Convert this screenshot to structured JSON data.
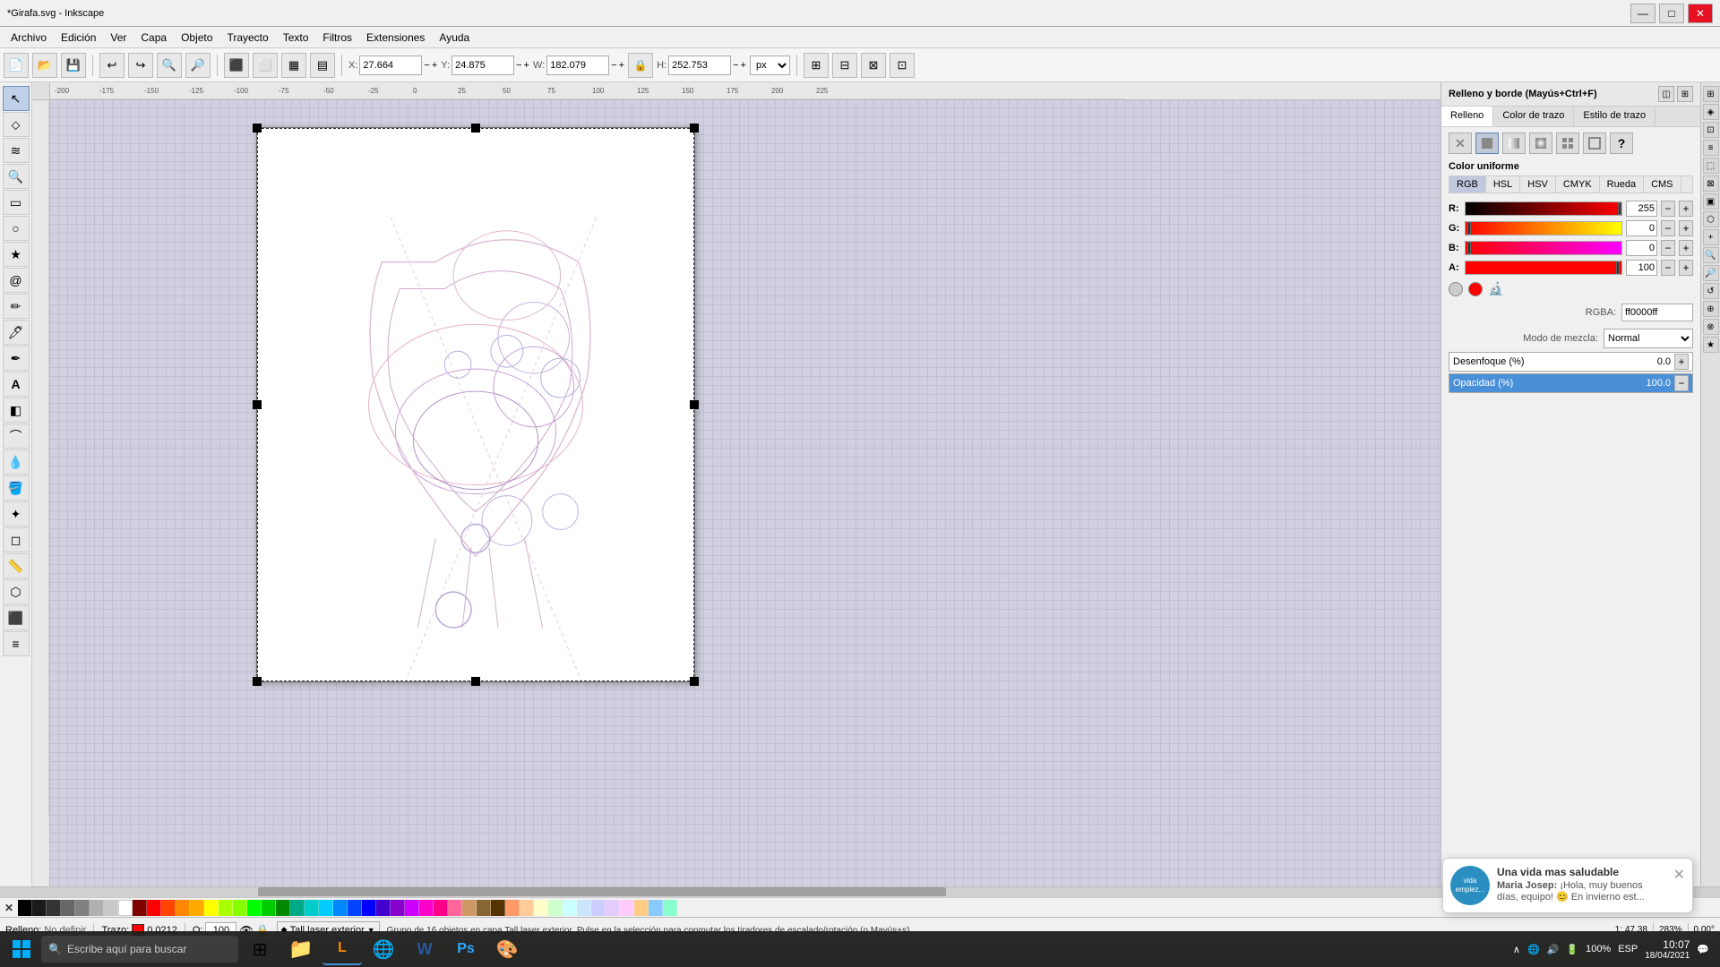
{
  "window": {
    "title": "*Girafa.svg - Inkscape",
    "controls": {
      "minimize": "—",
      "maximize": "□",
      "close": "✕"
    }
  },
  "menubar": {
    "items": [
      "Archivo",
      "Edición",
      "Ver",
      "Capa",
      "Objeto",
      "Trayecto",
      "Texto",
      "Filtros",
      "Extensiones",
      "Ayuda"
    ]
  },
  "toolbar": {
    "x_label": "X:",
    "x_value": "27.664",
    "y_label": "Y:",
    "y_value": "24.875",
    "w_label": "W:",
    "w_value": "182.079",
    "h_label": "H:",
    "h_value": "252.753",
    "unit": "px"
  },
  "panel": {
    "title": "Relleno y borde (Mayús+Ctrl+F)",
    "tabs": [
      "Relleno",
      "Color de trazo",
      "Estilo de trazo"
    ],
    "fill_types": [
      "?",
      "□",
      "□",
      "□",
      "□",
      "□",
      "?"
    ],
    "color_label": "Color uniforme",
    "color_mode_tabs": [
      "RGB",
      "HSL",
      "HSV",
      "CMYK",
      "Rueda",
      "CMS"
    ],
    "r_label": "R:",
    "r_value": "255",
    "g_label": "G:",
    "g_value": "0",
    "b_label": "B:",
    "b_value": "0",
    "a_label": "A:",
    "a_value": "100",
    "rgba_label": "RGBA:",
    "rgba_value": "ff0000ff",
    "blend_label": "Modo de mezcla:",
    "blend_value": "Normal",
    "blur_label": "Desenfoque (%)",
    "blur_value": "0.0",
    "opacity_label": "Opacidad (%)",
    "opacity_value": "100.0"
  },
  "statusbar": {
    "fill_label": "Relleno:",
    "fill_value": "No definir",
    "stroke_label": "Trazo:",
    "opacity_label": "O:",
    "opacity_value": "100",
    "layer_selector": "Tall laser exterior",
    "status_text": "Grupo de 16 objetos en capa Tall laser exterior. Pulse en la selección para conmutar los tiradores de escalado/rotación (o Mayús+s).",
    "zoom_value": "283%",
    "rotation_value": "0.00°",
    "coords": "1: 47.38"
  },
  "palette": {
    "colors": [
      "#000000",
      "#ffffff",
      "#808080",
      "#c0c0c0",
      "#800000",
      "#ff0000",
      "#ff6600",
      "#ff9900",
      "#ffcc00",
      "#ffff00",
      "#99cc00",
      "#00ff00",
      "#00cc00",
      "#006600",
      "#00ffcc",
      "#00ccff",
      "#0099ff",
      "#0066ff",
      "#0000ff",
      "#6600cc",
      "#9900cc",
      "#cc00ff",
      "#ff00cc",
      "#ff0099",
      "#ff6699",
      "#cc9966",
      "#996633",
      "#663300",
      "#ff9966",
      "#ffcc99",
      "#ffffcc",
      "#ccffcc",
      "#ccffff",
      "#cce5ff",
      "#ccccff",
      "#e5ccff"
    ]
  },
  "notification": {
    "title": "Una vida mas saludable",
    "sender": "Maria Josep:",
    "text": "¡Hola, muy buenos días, equipo! 😊 En invierno est...",
    "avatar_text": "vida\nempiez..."
  },
  "taskbar": {
    "search_placeholder": "Escribe aquí para buscar",
    "time": "10:07",
    "date": "18/04/2021",
    "lang": "ESP",
    "battery": "100%"
  }
}
